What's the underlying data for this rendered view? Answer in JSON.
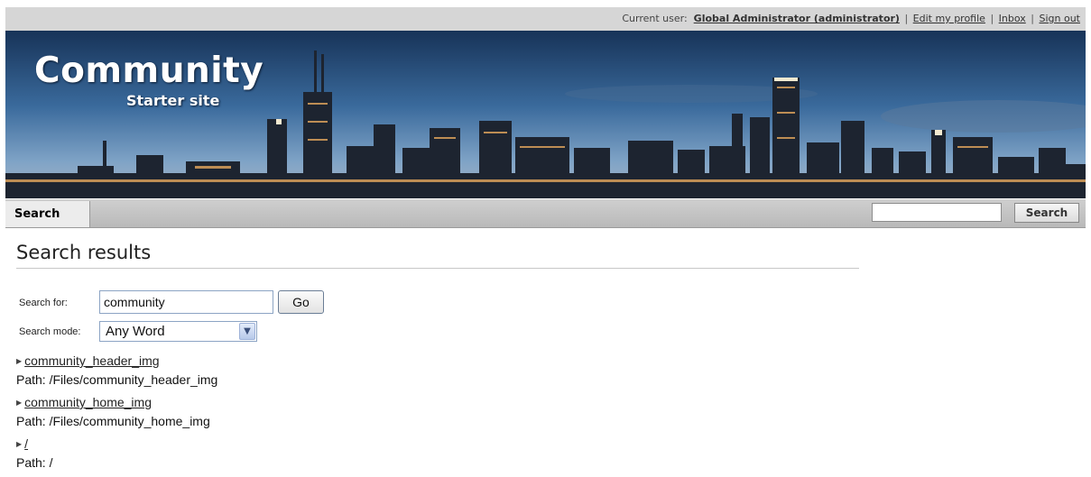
{
  "topbar": {
    "current_user_label": "Current user:",
    "user_name": "Global Administrator (administrator)",
    "links": [
      "Edit my profile",
      "Inbox",
      "Sign out"
    ]
  },
  "header": {
    "logo_title": "Community",
    "logo_subtitle": "Starter site"
  },
  "nav": {
    "active_tab": "Search",
    "search_button": "Search",
    "search_value": ""
  },
  "main": {
    "title": "Search results",
    "search_for_label": "Search for:",
    "search_value": "community",
    "go_button": "Go",
    "search_mode_label": "Search mode:",
    "search_mode_value": "Any Word",
    "results": [
      {
        "title": "community_header_img",
        "path": "Path: /Files/community_header_img"
      },
      {
        "title": "community_home_img",
        "path": "Path: /Files/community_home_img"
      },
      {
        "title": "/",
        "path": "Path: /"
      }
    ]
  },
  "colors": {
    "topbar_bg": "#d6d6d6",
    "navbar_bg": "#c4c4c4",
    "sky_top": "#173358",
    "sky_bottom": "#a9b7c4"
  }
}
